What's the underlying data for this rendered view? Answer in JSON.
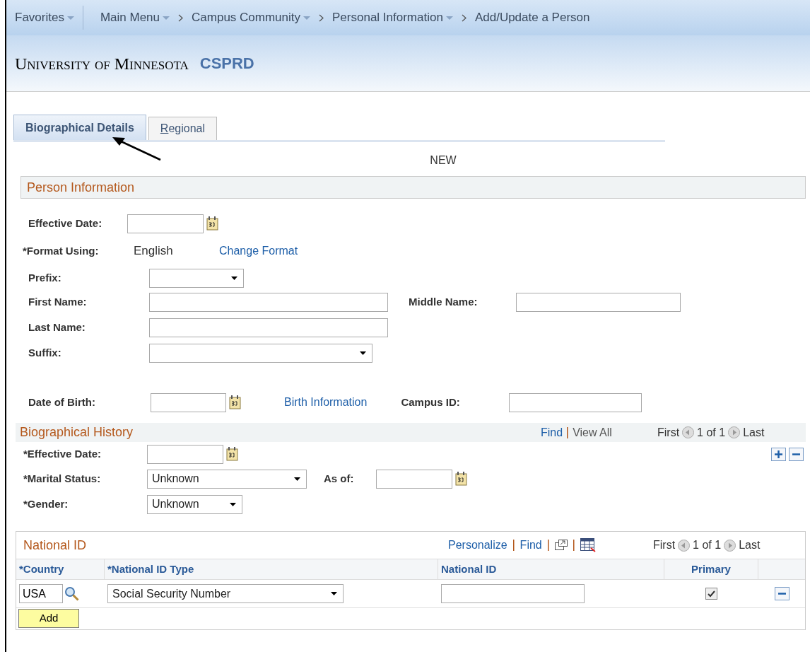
{
  "nav": {
    "favorites": "Favorites",
    "items": [
      {
        "label": "Main Menu",
        "dropdown": true
      },
      {
        "label": "Campus Community",
        "dropdown": true
      },
      {
        "label": "Personal Information",
        "dropdown": true
      },
      {
        "label": "Add/Update a Person",
        "dropdown": false
      }
    ]
  },
  "branding": {
    "university": "University of Minnesota",
    "database": "CSPRD"
  },
  "tabs": [
    {
      "label": "Biographical Details",
      "selected": true,
      "access_key_underlined": false
    },
    {
      "label": "Regional",
      "selected": false,
      "access_key_underlined": true
    }
  ],
  "mode": "NEW",
  "person_information": {
    "title": "Person Information",
    "effective_date": {
      "label": "Effective Date:"
    },
    "format_using": {
      "label": "*Format Using:",
      "value": "English",
      "link": "Change Format"
    },
    "prefix": {
      "label": "Prefix:"
    },
    "first_name": {
      "label": "First Name:"
    },
    "middle_name": {
      "label": "Middle Name:"
    },
    "last_name": {
      "label": "Last Name:"
    },
    "suffix": {
      "label": "Suffix:"
    },
    "date_of_birth": {
      "label": "Date of Birth:"
    },
    "birth_link": "Birth Information",
    "campus_id": {
      "label": "Campus ID:"
    }
  },
  "biographical_history": {
    "title": "Biographical History",
    "links": [
      "Find",
      "View All"
    ],
    "pager": {
      "first": "First",
      "count": "1 of 1",
      "last": "Last"
    },
    "effective_date": {
      "label": "*Effective Date:"
    },
    "marital_status": {
      "label": "*Marital Status:",
      "value": "Unknown"
    },
    "as_of": {
      "label": "As of:"
    },
    "gender": {
      "label": "*Gender:",
      "value": "Unknown"
    }
  },
  "national_id": {
    "title": "National ID",
    "links": [
      "Personalize",
      "Find"
    ],
    "pager": {
      "first": "First",
      "count": "1 of 1",
      "last": "Last"
    },
    "columns": [
      "*Country",
      "*National ID Type",
      "National ID",
      "Primary"
    ],
    "rows": [
      {
        "country": "USA",
        "type": "Social Security Number",
        "primary": true
      }
    ],
    "add_button": "Add"
  }
}
